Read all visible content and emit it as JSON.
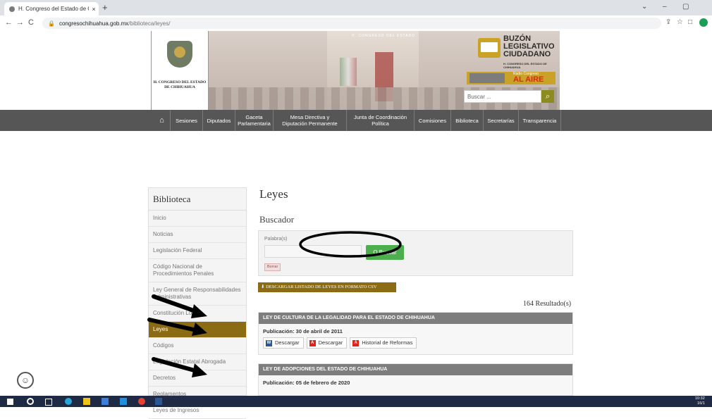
{
  "browser": {
    "tab_title": "H. Congreso del Estado de Chih",
    "tab_close": "×",
    "new_tab": "+",
    "url_host": "congresochihuahua.gob.mx",
    "url_path": "/biblioteca/leyes/",
    "back": "←",
    "forward": "→",
    "reload": "C",
    "lock": "🔒",
    "win_min": "–",
    "win_max": "▢",
    "win_menu": "⌄",
    "share": "⇪",
    "star": "☆",
    "ext": "□",
    "profile": "●"
  },
  "header": {
    "logo_text": "H. CONGRESO DEL ESTADO DE CHIHUAHUA",
    "hero_caption": "H. CONGRESO DEL ESTADO",
    "buzon_title": "BUZÓN LEGISLATIVO CIUDADANO",
    "buzon_sub": "H. CONGRESO DEL ESTADO DE CHIHUAHUA",
    "radio_top": "Radio Congreso",
    "radio_main": "AL AIRE",
    "search_placeholder": "Buscar ...",
    "search_icon": "🔍"
  },
  "nav": {
    "home_icon": "⌂",
    "items": [
      "Sesiones",
      "Diputados",
      "Gaceta Parlamentaria",
      "Mesa Directiva y Diputación Permanente",
      "Junta de Coordinación Política",
      "Comisiones",
      "Biblioteca",
      "Secretarías",
      "Transparencia"
    ]
  },
  "sidebar": {
    "title": "Biblioteca",
    "items": [
      "Inicio",
      "Noticias",
      "Legislación Federal",
      "Código Nacional de Procedimientos Penales",
      "Ley General de Responsabilidades Administrativas",
      "Constitución Local",
      "Leyes",
      "Códigos",
      "Legislación Estatal Abrogada",
      "Decretos",
      "Reglamentos",
      "Leyes de Ingresos"
    ],
    "active_index": 6
  },
  "main": {
    "title": "Leyes",
    "search_title": "Buscador",
    "search_label": "Palabra(s)",
    "search_button": "Q Buscar",
    "clear_button": "Borrar",
    "csv_button": "⬇ DESCARGAR LISTADO DE LEYES EN FORMATO CSV",
    "results": "164 Resultado(s)",
    "laws": [
      {
        "name": "LEY DE CULTURA DE LA LEGALIDAD PARA EL ESTADO DE CHIHUAHUA",
        "publication": "Publicación: 30 de abril de 2011",
        "buttons": [
          "Descargar",
          "Descargar",
          "Historial de Reformas"
        ]
      },
      {
        "name": "LEY DE ADOPCIONES DEL ESTADO DE CHIHUAHUA",
        "publication": "Publicación: 05 de febrero de 2020",
        "buttons": []
      }
    ]
  },
  "taskbar": {
    "time": "10:32",
    "date": "16/1"
  },
  "colors": {
    "nav_bg": "#565656",
    "accent_gold": "#8b6b14",
    "search_green": "#4cae4c",
    "law_header": "#7d7d7d"
  }
}
